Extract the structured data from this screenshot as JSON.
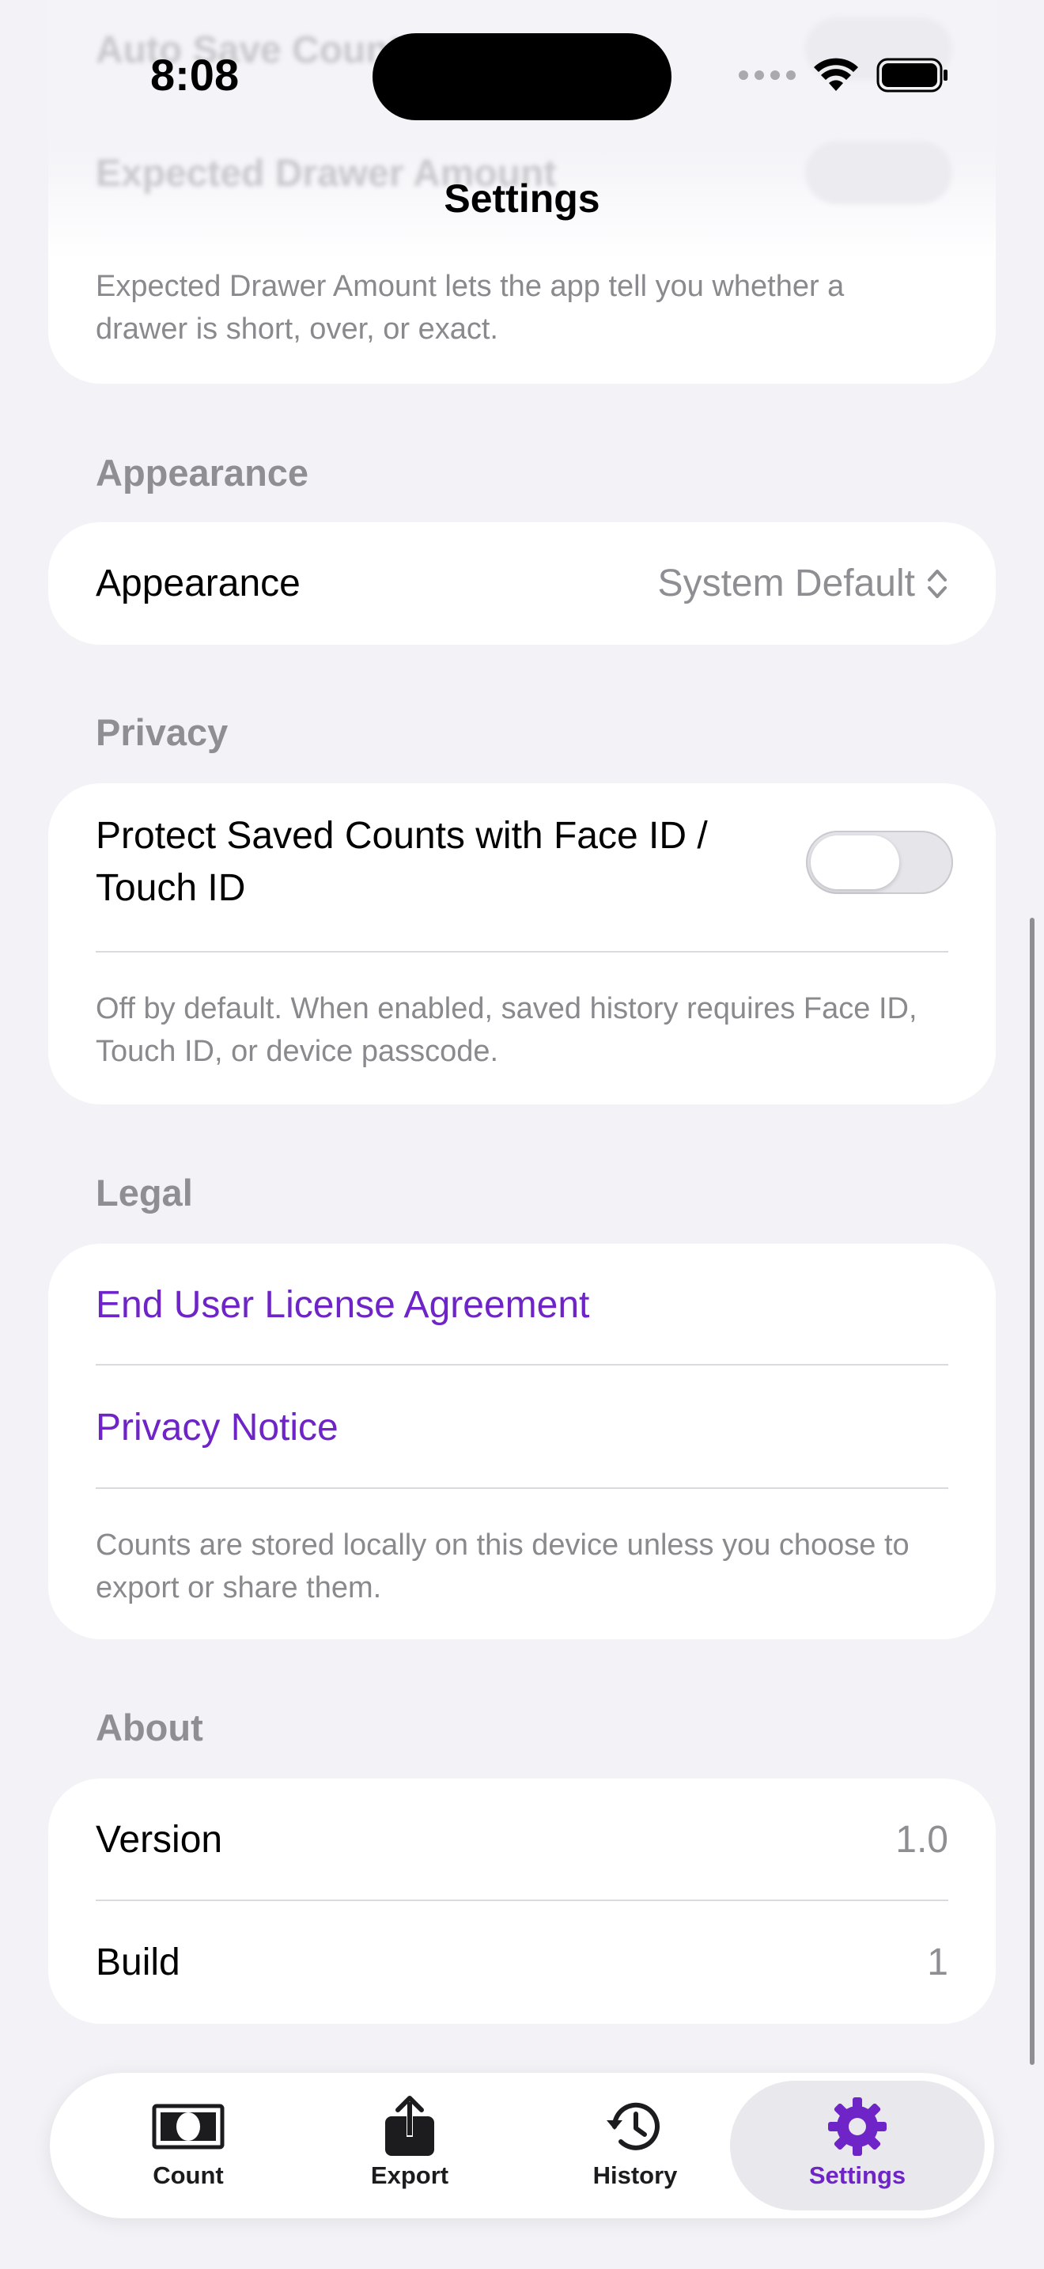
{
  "status_bar": {
    "time": "8:08"
  },
  "nav": {
    "title": "Settings"
  },
  "ghost_rows": {
    "auto_save": "Auto Save Count",
    "expected_drawer": "Expected Drawer Amount"
  },
  "top_card": {
    "footnote": "Expected Drawer Amount lets the app tell you whether a drawer is short, over, or exact."
  },
  "appearance": {
    "header": "Appearance",
    "row_label": "Appearance",
    "value": "System Default"
  },
  "privacy": {
    "header": "Privacy",
    "toggle_label": "Protect Saved Counts with Face ID / Touch ID",
    "toggle_on": false,
    "footnote": "Off by default. When enabled, saved history requires Face ID, Touch ID, or device passcode."
  },
  "legal": {
    "header": "Legal",
    "eula": "End User License Agreement",
    "privacy_notice": "Privacy Notice",
    "footnote": "Counts are stored locally on this device unless you choose to export or share them."
  },
  "about": {
    "header": "About",
    "version_label": "Version",
    "version_value": "1.0",
    "build_label": "Build",
    "build_value": "1"
  },
  "tabbar": {
    "tabs": [
      {
        "label": "Count",
        "icon": "banknote-icon"
      },
      {
        "label": "Export",
        "icon": "share-icon"
      },
      {
        "label": "History",
        "icon": "history-clock-icon"
      },
      {
        "label": "Settings",
        "icon": "gear-icon"
      }
    ],
    "active_index": 3
  },
  "colors": {
    "accent": "#6f24c7",
    "background": "#f2f2f7",
    "card": "#ffffff",
    "secondary_text": "#8e8e93"
  }
}
